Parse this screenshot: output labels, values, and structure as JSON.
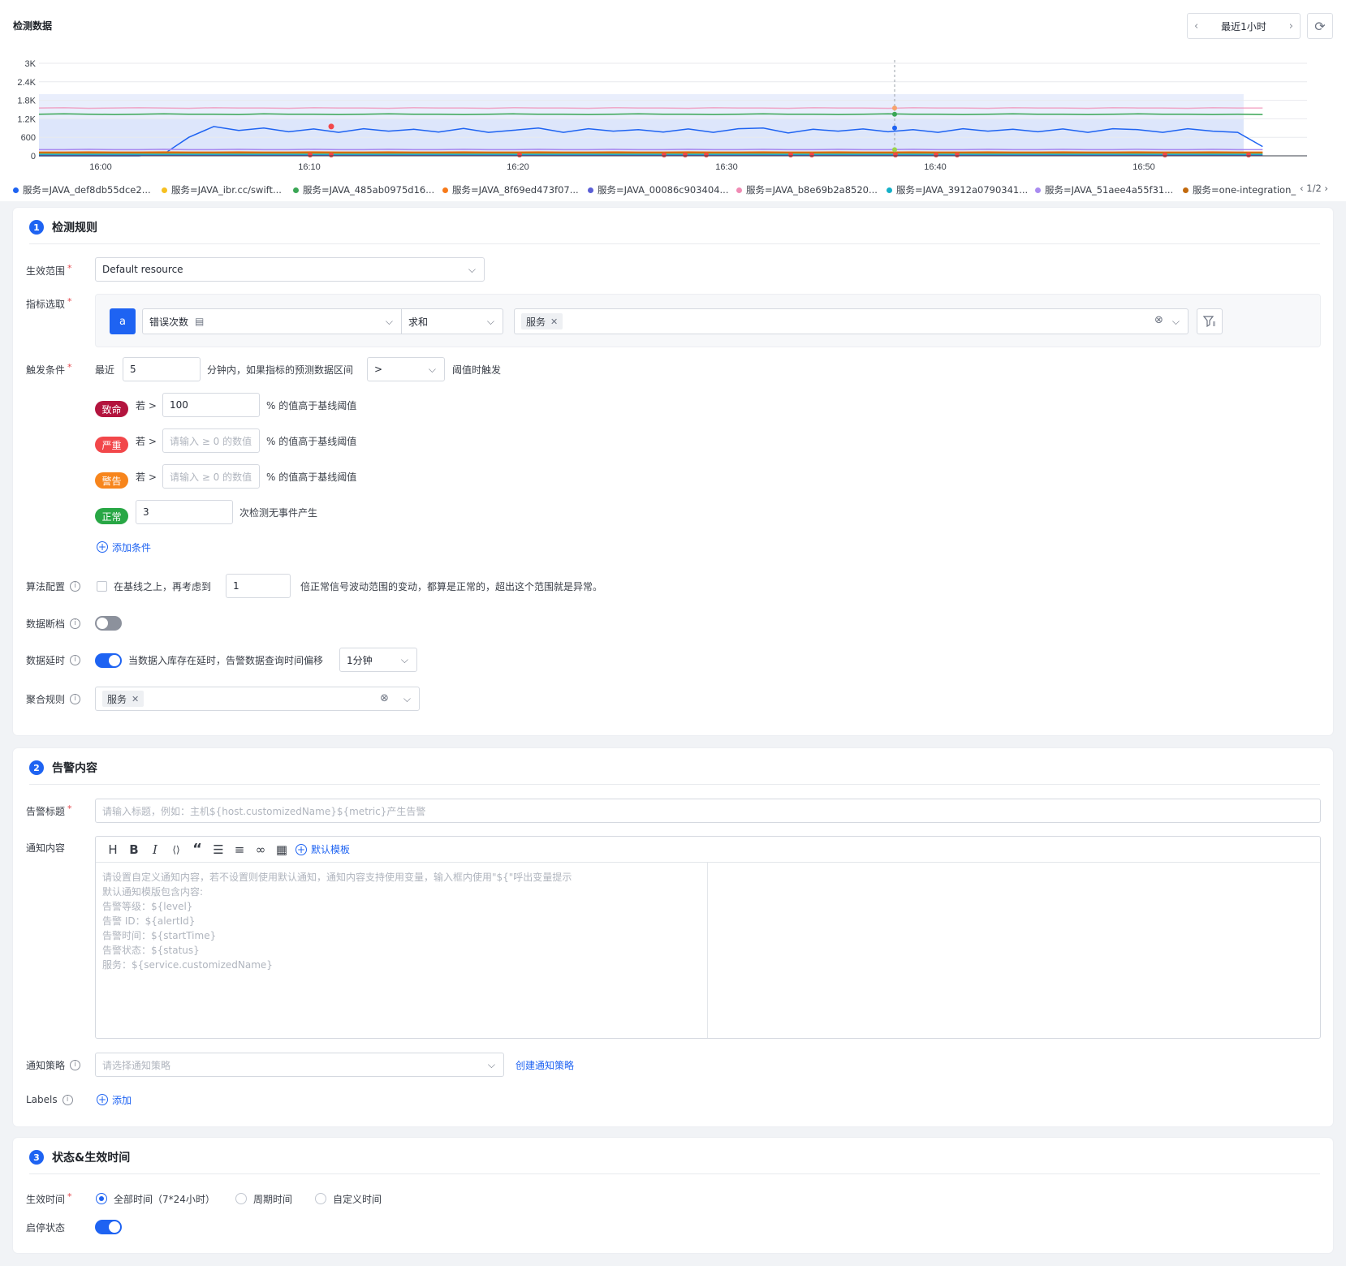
{
  "header": {
    "title": "检测数据",
    "time_range": "最近1小时"
  },
  "chart_data": {
    "type": "line",
    "yticks": [
      "0",
      "600",
      "1.2K",
      "1.8K",
      "2.4K",
      "3K"
    ],
    "ylim": [
      0,
      3000
    ],
    "x": [
      "16:00",
      "16:10",
      "16:20",
      "16:30",
      "16:40",
      "16:50"
    ],
    "grid": true,
    "legend_position": "bottom",
    "legend_page": "1/2",
    "series": [
      {
        "name": "服务=JAVA_def8db55dce2...",
        "color": "#1e63f2",
        "values": [
          0,
          0,
          0,
          0,
          0,
          60,
          600,
          950,
          820,
          900,
          780,
          870,
          760,
          880,
          800,
          860,
          770,
          890,
          760,
          830,
          900,
          760,
          880,
          800,
          850,
          770,
          870,
          760,
          880,
          900,
          740,
          860,
          800,
          870,
          780,
          850,
          760,
          880,
          800,
          860,
          780,
          870,
          760,
          880,
          850,
          760,
          880,
          800,
          760,
          300
        ]
      },
      {
        "name": "服务=JAVA_ibr.cc/swift...",
        "color": "#f6c021",
        "values": [
          80,
          80,
          80,
          80,
          80,
          80,
          80,
          80,
          80,
          80,
          80,
          80,
          80,
          80,
          80,
          80,
          80,
          80,
          80,
          80,
          80,
          80,
          80,
          80,
          80,
          80,
          80,
          80,
          80,
          80,
          80,
          80,
          80,
          80,
          80,
          80,
          80,
          80,
          80,
          80,
          80,
          80,
          80,
          80,
          80,
          80,
          80,
          80,
          80,
          80
        ]
      },
      {
        "name": "服务=JAVA_485ab0975d16...",
        "color": "#3aa655",
        "values": [
          1350,
          1360,
          1350,
          1340,
          1350,
          1360,
          1350,
          1350,
          1340,
          1360,
          1350,
          1350,
          1340,
          1350,
          1360,
          1350,
          1350,
          1340,
          1350,
          1360,
          1350,
          1350,
          1340,
          1350,
          1360,
          1350,
          1350,
          1340,
          1350,
          1360,
          1350,
          1350,
          1340,
          1350,
          1360,
          1350,
          1350,
          1340,
          1350,
          1360,
          1350,
          1350,
          1340,
          1350,
          1360,
          1350,
          1350,
          1340,
          1350,
          1340
        ]
      },
      {
        "name": "服务=JAVA_8f69ed473f07...",
        "color": "#f77a1a",
        "values": [
          120,
          120,
          130,
          120,
          120,
          130,
          120,
          120,
          130,
          120,
          120,
          130,
          120,
          120,
          130,
          120,
          120,
          130,
          120,
          120,
          130,
          120,
          120,
          130,
          120,
          120,
          130,
          120,
          120,
          130,
          120,
          120,
          130,
          120,
          120,
          130,
          120,
          120,
          130,
          120,
          120,
          130,
          120,
          120,
          130,
          120,
          120,
          130,
          120,
          120
        ]
      },
      {
        "name": "服务=JAVA_00086c903404...",
        "color": "#5b5fd6",
        "values": [
          20,
          20,
          20,
          20,
          20,
          20,
          20,
          20,
          20,
          20,
          20,
          20,
          20,
          20,
          20,
          20,
          20,
          20,
          20,
          20,
          20,
          20,
          20,
          20,
          20,
          20,
          20,
          20,
          20,
          20,
          20,
          20,
          20,
          20,
          20,
          20,
          20,
          20,
          20,
          20,
          20,
          20,
          20,
          20,
          20,
          20,
          20,
          20,
          20,
          20
        ]
      },
      {
        "name": "服务=JAVA_b8e69b2a8520...",
        "color": "#f08bb4",
        "values": [
          1550,
          1560,
          1540,
          1550,
          1560,
          1550,
          1540,
          1560,
          1550,
          1550,
          1540,
          1560,
          1550,
          1550,
          1540,
          1560,
          1550,
          1550,
          1540,
          1560,
          1550,
          1550,
          1540,
          1560,
          1550,
          1550,
          1540,
          1560,
          1550,
          1550,
          1540,
          1560,
          1550,
          1550,
          1540,
          1560,
          1550,
          1550,
          1540,
          1560,
          1550,
          1550,
          1540,
          1560,
          1550,
          1550,
          1540,
          1560,
          1550,
          1550
        ]
      },
      {
        "name": "服务=JAVA_3912a0790341...",
        "color": "#15b0c8",
        "values": [
          50,
          50,
          50,
          50,
          50,
          50,
          50,
          50,
          50,
          50,
          50,
          50,
          50,
          50,
          50,
          50,
          50,
          50,
          50,
          50,
          50,
          50,
          50,
          50,
          50,
          50,
          50,
          50,
          50,
          50,
          50,
          50,
          50,
          50,
          50,
          50,
          50,
          50,
          50,
          50,
          50,
          50,
          50,
          50,
          50,
          50,
          50,
          50,
          50,
          50
        ]
      },
      {
        "name": "服务=JAVA_51aee4a55f31...",
        "color": "#a98bf0",
        "values": [
          200,
          200,
          210,
          200,
          200,
          210,
          200,
          200,
          210,
          200,
          200,
          210,
          200,
          200,
          210,
          200,
          200,
          210,
          200,
          200,
          210,
          200,
          200,
          210,
          200,
          200,
          210,
          200,
          200,
          210,
          200,
          200,
          210,
          200,
          200,
          210,
          200,
          200,
          210,
          200,
          200,
          210,
          200,
          200,
          210,
          200,
          200,
          210,
          200,
          200
        ]
      },
      {
        "name": "服务=one-integration_",
        "color": "#c26a0e",
        "values": [
          100,
          100,
          100,
          100,
          100,
          100,
          100,
          100,
          100,
          100,
          100,
          100,
          100,
          100,
          100,
          100,
          100,
          100,
          100,
          100,
          100,
          100,
          100,
          100,
          100,
          100,
          100,
          100,
          100,
          100,
          100,
          100,
          100,
          100,
          100,
          100,
          100,
          100,
          100,
          100,
          100,
          100,
          100,
          100,
          100,
          100,
          100,
          100,
          100,
          100
        ]
      }
    ],
    "band_series": [
      {
        "upper": [
          2000,
          1200
        ],
        "lower": [
          0,
          0
        ]
      }
    ]
  },
  "rules": {
    "num": "1",
    "title": "检测规则",
    "scope_label": "生效范围",
    "scope_value": "Default resource",
    "metric_label": "指标选取",
    "metric_id": "a",
    "metric_name": "错误次数",
    "metric_agg": "求和",
    "metric_tag": "服务",
    "trigger_label": "触发条件",
    "trigger_recent": "最近",
    "trigger_minutes": "5",
    "trigger_text": "分钟内，如果指标的预测数据区间",
    "trigger_op": ">",
    "trigger_tail": "阈值时触发",
    "levels": [
      {
        "badge": "致命",
        "cond": "若 >",
        "value": "100",
        "placeholder": "",
        "suffix": "% 的值高于基线阈值",
        "color": "#b3143e"
      },
      {
        "badge": "严重",
        "cond": "若 >",
        "value": "",
        "placeholder": "请输入 ≥ 0 的数值",
        "suffix": "% 的值高于基线阈值",
        "color": "#f2474a"
      },
      {
        "badge": "警告",
        "cond": "若 >",
        "value": "",
        "placeholder": "请输入 ≥ 0 的数值",
        "suffix": "% 的值高于基线阈值",
        "color": "#f7851c"
      }
    ],
    "normal_badge": "正常",
    "normal_value": "3",
    "normal_suffix": "次检测无事件产生",
    "normal_color": "#28a745",
    "add_condition": "添加条件",
    "algo_label": "算法配置",
    "algo_pre": "在基线之上，再考虑到",
    "algo_value": "1",
    "algo_post": "倍正常信号波动范围的变动，都算是正常的，超出这个范围就是异常。",
    "gap_label": "数据断档",
    "gap_on": false,
    "delay_label": "数据延时",
    "delay_on": true,
    "delay_text": "当数据入库存在延时，告警数据查询时间偏移",
    "delay_value": "1分钟",
    "agg_label": "聚合规则",
    "agg_tag": "服务"
  },
  "content": {
    "num": "2",
    "title": "告警内容",
    "alert_title_label": "告警标题",
    "alert_title_placeholder": "请输入标题，例如：主机${host.customizedName}${metric}产生告警",
    "notify_label": "通知内容",
    "default_template": "默认模板",
    "editor_placeholder": [
      "请设置自定义通知内容，若不设置则使用默认通知，通知内容支持使用变量，输入框内使用\"${\"呼出变量提示",
      "默认通知模版包含内容:",
      "告警等级：${level}",
      "告警 ID：${alertId}",
      "告警时间：${startTime}",
      "告警状态：${status}",
      "服务：${service.customizedName}"
    ],
    "policy_label": "通知策略",
    "policy_placeholder": "请选择通知策略",
    "create_policy": "创建通知策略",
    "labels_label": "Labels",
    "add_label": "添加"
  },
  "status": {
    "num": "3",
    "title": "状态&生效时间",
    "effect_label": "生效时间",
    "options": [
      "全部时间（7*24小时）",
      "周期时间",
      "自定义时间"
    ],
    "selected": 0,
    "enable_label": "启停状态",
    "enabled": true
  },
  "colors": {
    "accent": "#1e63f2",
    "toggle_off": "#8c919c"
  },
  "icons": [
    "chevron-left-icon",
    "chevron-right-icon",
    "refresh-icon",
    "chevron-down-icon",
    "clear-icon",
    "filter-icon",
    "info-icon",
    "plus-circle-icon",
    "heading-icon",
    "bold-icon",
    "italic-icon",
    "code-icon",
    "quote-icon",
    "bullet-list-icon",
    "ordered-list-icon",
    "link-icon",
    "table-icon"
  ]
}
